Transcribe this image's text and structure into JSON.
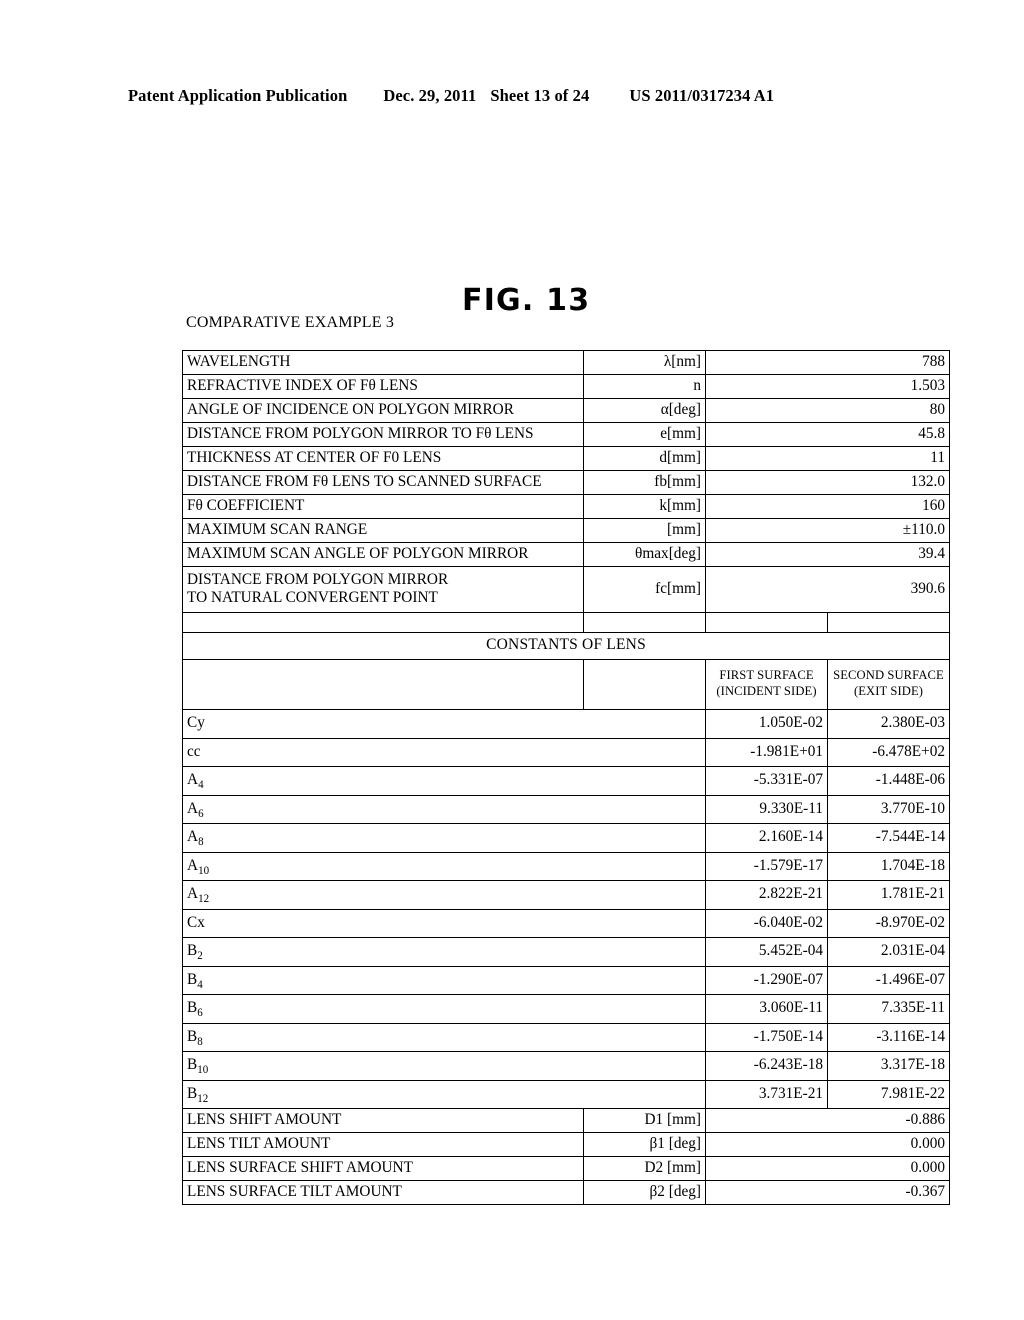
{
  "header": {
    "publication": "Patent Application Publication",
    "date": "Dec. 29, 2011",
    "sheet": "Sheet 13 of 24",
    "patent_number": "US 2011/0317234 A1"
  },
  "figure": {
    "title": "FIG. 13",
    "subtitle": "COMPARATIVE EXAMPLE 3"
  },
  "table": {
    "parameters": [
      {
        "label": "WAVELENGTH",
        "symbol": "λ[nm]",
        "value": "788"
      },
      {
        "label": "REFRACTIVE INDEX OF Fθ LENS",
        "symbol": "n",
        "value": "1.503"
      },
      {
        "label": "ANGLE OF INCIDENCE ON POLYGON MIRROR",
        "symbol": "α[deg]",
        "value": "80"
      },
      {
        "label": "DISTANCE FROM POLYGON MIRROR TO Fθ LENS",
        "symbol": "e[mm]",
        "value": "45.8"
      },
      {
        "label": "THICKNESS AT CENTER OF F0 LENS",
        "symbol": "d[mm]",
        "value": "11"
      },
      {
        "label": "DISTANCE FROM Fθ LENS TO SCANNED SURFACE",
        "symbol": "fb[mm]",
        "value": "132.0"
      },
      {
        "label": "Fθ COEFFICIENT",
        "symbol": "k[mm]",
        "value": "160"
      },
      {
        "label": "MAXIMUM SCAN RANGE",
        "symbol": "[mm]",
        "value": "±110.0"
      },
      {
        "label": "MAXIMUM SCAN ANGLE OF POLYGON MIRROR",
        "symbol": "θmax[deg]",
        "value": "39.4"
      }
    ],
    "parameter_twoline": {
      "label_line1": "DISTANCE FROM POLYGON MIRROR",
      "label_line2": "TO NATURAL CONVERGENT POINT",
      "symbol": "fc[mm]",
      "value": "390.6"
    },
    "section_title": "CONSTANTS OF LENS",
    "column_headers": {
      "first_surface_line1": "FIRST SURFACE",
      "first_surface_line2": "(INCIDENT SIDE)",
      "second_surface_line1": "SECOND SURFACE",
      "second_surface_line2": "(EXIT SIDE)"
    },
    "constants": [
      {
        "name": "Cy",
        "sub": "",
        "first": "1.050E-02",
        "second": "2.380E-03"
      },
      {
        "name": "cc",
        "sub": "",
        "first": "-1.981E+01",
        "second": "-6.478E+02"
      },
      {
        "name": "A",
        "sub": "4",
        "first": "-5.331E-07",
        "second": "-1.448E-06"
      },
      {
        "name": "A",
        "sub": "6",
        "first": "9.330E-11",
        "second": "3.770E-10"
      },
      {
        "name": "A",
        "sub": "8",
        "first": "2.160E-14",
        "second": "-7.544E-14"
      },
      {
        "name": "A",
        "sub": "10",
        "first": "-1.579E-17",
        "second": "1.704E-18"
      },
      {
        "name": "A",
        "sub": "12",
        "first": "2.822E-21",
        "second": "1.781E-21"
      },
      {
        "name": "Cx",
        "sub": "",
        "first": "-6.040E-02",
        "second": "-8.970E-02"
      },
      {
        "name": "B",
        "sub": "2",
        "first": "5.452E-04",
        "second": "2.031E-04"
      },
      {
        "name": "B",
        "sub": "4",
        "first": "-1.290E-07",
        "second": "-1.496E-07"
      },
      {
        "name": "B",
        "sub": "6",
        "first": "3.060E-11",
        "second": "7.335E-11"
      },
      {
        "name": "B",
        "sub": "8",
        "first": "-1.750E-14",
        "second": "-3.116E-14"
      },
      {
        "name": "B",
        "sub": "10",
        "first": "-6.243E-18",
        "second": "3.317E-18"
      },
      {
        "name": "B",
        "sub": "12",
        "first": "3.731E-21",
        "second": "7.981E-22"
      }
    ],
    "adjustments": [
      {
        "label": "LENS SHIFT AMOUNT",
        "symbol": "D1 [mm]",
        "value": "-0.886"
      },
      {
        "label": "LENS TILT AMOUNT",
        "symbol": "β1 [deg]",
        "value": "0.000"
      },
      {
        "label": "LENS SURFACE SHIFT AMOUNT",
        "symbol": "D2 [mm]",
        "value": "0.000"
      },
      {
        "label": "LENS SURFACE TILT AMOUNT",
        "symbol": "β2 [deg]",
        "value": "-0.367"
      }
    ]
  }
}
